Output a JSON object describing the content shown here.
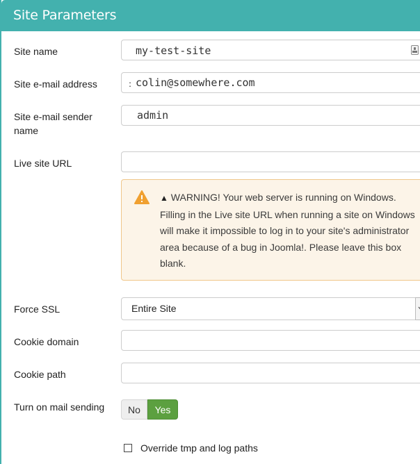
{
  "header": {
    "title": "Site Parameters"
  },
  "fields": {
    "site_name": {
      "label": "Site name",
      "value": "my-test-site"
    },
    "site_email": {
      "label": "Site e-mail address",
      "value": "colin@somewhere.com"
    },
    "sender_name": {
      "label_line1": "Site e-mail sender",
      "label_line2": "name",
      "value": "admin"
    },
    "live_site_url": {
      "label": "Live site URL",
      "value": ""
    },
    "force_ssl": {
      "label": "Force SSL",
      "value": "Entire Site"
    },
    "cookie_domain": {
      "label": "Cookie domain",
      "value": ""
    },
    "cookie_path": {
      "label": "Cookie path",
      "value": ""
    },
    "mail_sending": {
      "label": "Turn on mail sending",
      "no_label": "No",
      "yes_label": "Yes",
      "selected": "Yes"
    }
  },
  "warning": {
    "sign": "▲",
    "text": "WARNING! Your web server is running on Windows. Filling in the Live site URL when running a site on Windows will make it impossible to log in to your site's administrator area because of a bug in Joomla!. Please leave this box blank."
  },
  "override": {
    "label": "Override tmp and log paths",
    "checked": false
  },
  "colors": {
    "header": "#43b1ae",
    "yes_button": "#5ca040",
    "warning_bg": "#fcf4e8",
    "warning_icon": "#f0a030"
  },
  "icons": {
    "site_name_field": "password-manager-icon",
    "warning": "warning-triangle-icon",
    "select": "chevron-down-icon"
  }
}
